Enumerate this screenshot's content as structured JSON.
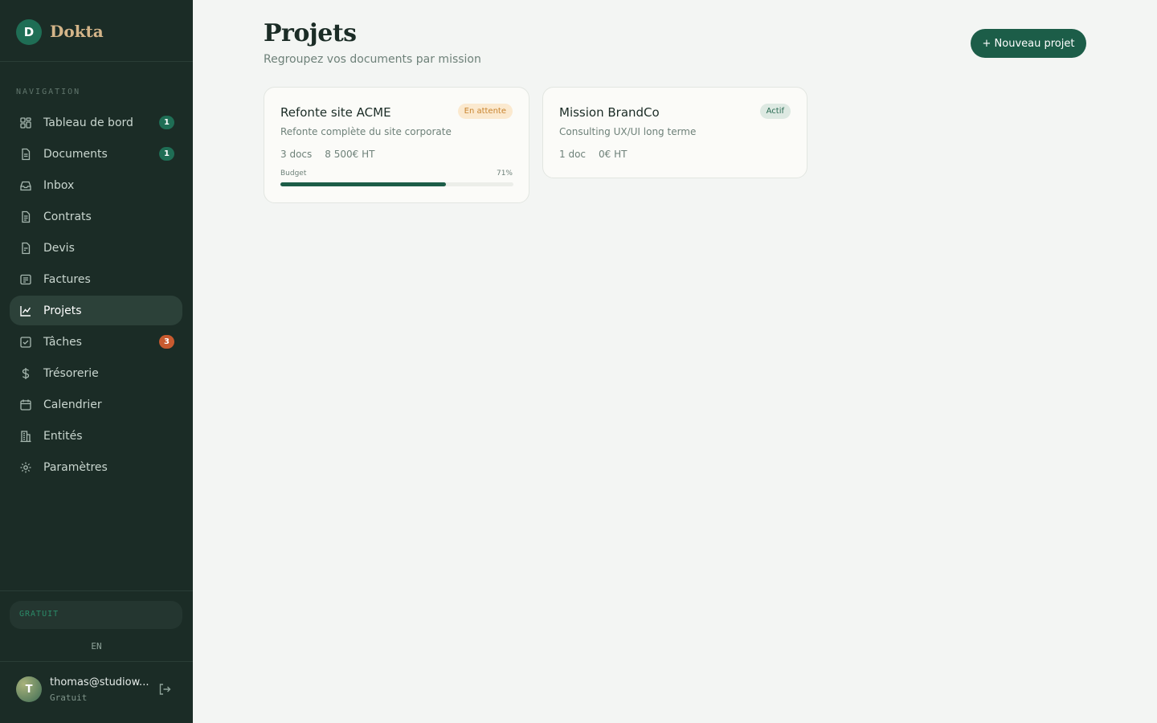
{
  "brand": {
    "initial": "D",
    "name": "Dokta"
  },
  "navigation": {
    "section_label": "NAVIGATION",
    "items": [
      {
        "label": "Tableau de bord",
        "icon": "dashboard-icon",
        "badge": "1",
        "badge_tone": "normal",
        "active": false
      },
      {
        "label": "Documents",
        "icon": "document-icon",
        "badge": "1",
        "badge_tone": "normal",
        "active": false
      },
      {
        "label": "Inbox",
        "icon": "inbox-icon",
        "badge": null,
        "active": false
      },
      {
        "label": "Contrats",
        "icon": "contract-icon",
        "badge": null,
        "active": false
      },
      {
        "label": "Devis",
        "icon": "quote-icon",
        "badge": null,
        "active": false
      },
      {
        "label": "Factures",
        "icon": "invoice-icon",
        "badge": null,
        "active": false
      },
      {
        "label": "Projets",
        "icon": "chart-line-icon",
        "badge": null,
        "active": true
      },
      {
        "label": "Tâches",
        "icon": "task-check-icon",
        "badge": "3",
        "badge_tone": "alert",
        "active": false
      },
      {
        "label": "Trésorerie",
        "icon": "dollar-icon",
        "badge": null,
        "active": false
      },
      {
        "label": "Calendrier",
        "icon": "calendar-icon",
        "badge": null,
        "active": false
      },
      {
        "label": "Entités",
        "icon": "building-icon",
        "badge": null,
        "active": false
      },
      {
        "label": "Paramètres",
        "icon": "gear-icon",
        "badge": null,
        "active": false
      }
    ]
  },
  "plan": {
    "label": "GRATUIT"
  },
  "language": "EN",
  "user": {
    "initial": "T",
    "email": "thomas@studiow...",
    "plan": "Gratuit"
  },
  "page": {
    "title": "Projets",
    "subtitle": "Regroupez vos documents par mission",
    "new_button_label": "+ Nouveau projet"
  },
  "projects": [
    {
      "title": "Refonte site ACME",
      "description": "Refonte complète du site corporate",
      "status": "En attente",
      "docs": "3 docs",
      "amount": "8 500€ HT",
      "budget_label": "Budget",
      "budget_percent_label": "71%",
      "budget_fraction": 0.71
    },
    {
      "title": "Mission BrandCo",
      "description": "Consulting UX/UI long terme",
      "status": "Actif",
      "docs": "1 doc",
      "amount": "0€ HT"
    }
  ],
  "colors": {
    "sidebar_bg": "#1b2c26",
    "accent_green": "#1c5d48",
    "brand_gold": "#d4b589",
    "alert_orange": "#c85a2f"
  }
}
